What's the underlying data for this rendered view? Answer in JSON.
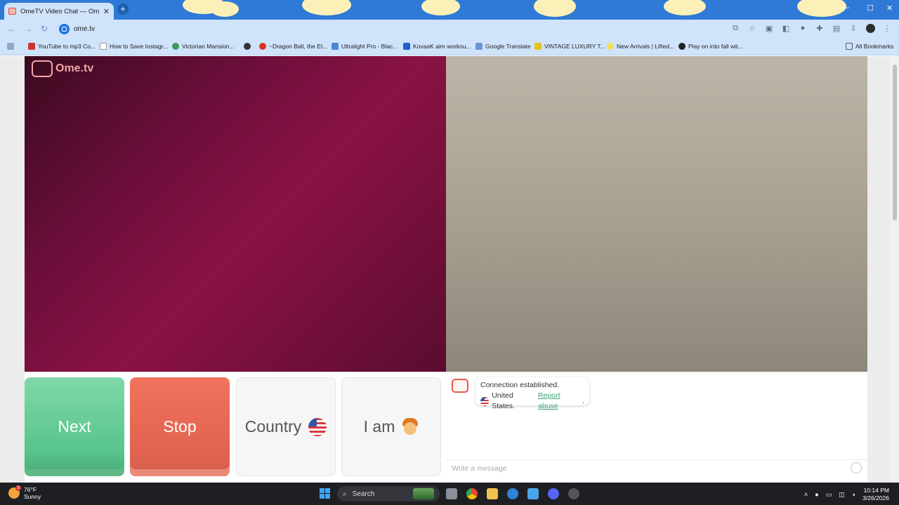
{
  "browser": {
    "tab_title": "OmeTV Video Chat — Ome",
    "new_tab_label": "+",
    "url": "ome.tv",
    "bookmarks": [
      "YouTube to mp3 Co...",
      "How to Save Instagr...",
      "Victorian Mansion...",
      "",
      "~Dragon Ball, the Et...",
      "Ultralight Pro - Blac...",
      "KovaaK aim workou...",
      "Google Translate",
      "VINTAGE LUXURY T...",
      "New Arrivals | Lifted...",
      "Play on into fall wit..."
    ],
    "all_bookmarks": "All Bookmarks",
    "accent": "#2f7ad6"
  },
  "site": {
    "logo_text": "Ome.tv",
    "buttons": {
      "next": "Next",
      "stop": "Stop",
      "country": "Country",
      "iam": "I am"
    },
    "colors": {
      "next": "#58c48c",
      "stop": "#e2634f"
    }
  },
  "chat": {
    "system_line1": "Connection established.",
    "country": "United States.",
    "report": "Report abuse",
    "period": ".",
    "placeholder": "Write a message"
  },
  "taskbar": {
    "temp": "76°F",
    "condition": "Sunny",
    "weather_badge": "3",
    "search_label": "Search",
    "time": "10:14 PM",
    "date": "3/26/2026"
  }
}
